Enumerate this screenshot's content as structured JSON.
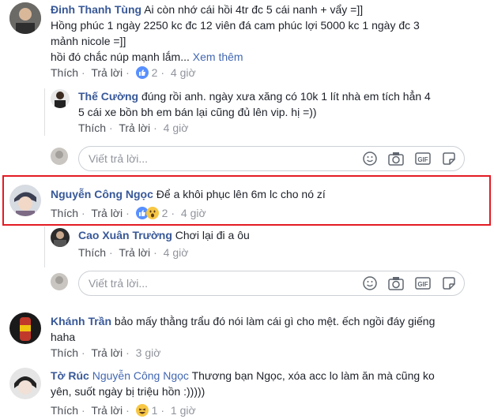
{
  "comments": [
    {
      "name": "Đinh Thanh Tùng",
      "line1": "Ai còn nhớ cái hồi 4tr đc 5 cái nanh + vẩy =]]",
      "line2": "Hồng phúc 1 ngày 2250 kc đc 12 viên đá cam phúc lợi 5000 kc 1 ngày đc 3",
      "line3": "mảnh nicole =]]",
      "line4": "hồi đó chắc núp mạnh lắm...",
      "see_more": "Xem thêm",
      "like": "Thích",
      "reply": "Trả lời",
      "reactions": "2",
      "time": "4 giờ"
    },
    {
      "name": "Thế Cường",
      "line1": "đúng rồi anh. ngày xưa xăng có 10k 1 lít nhà em tích hẳn 4",
      "line2": "5 cái xe bồn bh em bán lại cũng đủ lên vip. hị =))",
      "like": "Thích",
      "reply": "Trả lời",
      "time": "4 giờ"
    },
    {
      "name": "Nguyễn Công Ngọc",
      "line1": "Để a khôi phục lên 6m lc cho nó zí",
      "like": "Thích",
      "reply": "Trả lời",
      "reactions": "2",
      "time": "4 giờ"
    },
    {
      "name": "Cao Xuân Trường",
      "line1": "Chơi lại đi a ôu",
      "like": "Thích",
      "reply": "Trả lời",
      "time": "4 giờ"
    },
    {
      "name": "Khánh Trần",
      "line1": "bảo mấy thằng trẩu đó nói làm cái gì cho mệt. ếch ngồi đáy giếng",
      "line2": "haha",
      "like": "Thích",
      "reply": "Trả lời",
      "time": "3 giờ"
    },
    {
      "name": "Tờ Rúc",
      "mention": "Nguyễn Công Ngọc",
      "line1": "Thương bạn Ngọc, xóa acc lo làm ăn mà cũng ko",
      "line2": "yên, suốt ngày bị triệu hồn :)))))",
      "like": "Thích",
      "reply": "Trả lời",
      "reactions": "1",
      "time": "1 giờ"
    }
  ],
  "reply_placeholder": "Viết trả lời...",
  "icons": [
    "emoji-icon",
    "camera-icon",
    "gif-icon",
    "sticker-icon"
  ],
  "colors": {
    "name": "#385898",
    "highlight": "#e31b23",
    "meta": "#90949c"
  }
}
